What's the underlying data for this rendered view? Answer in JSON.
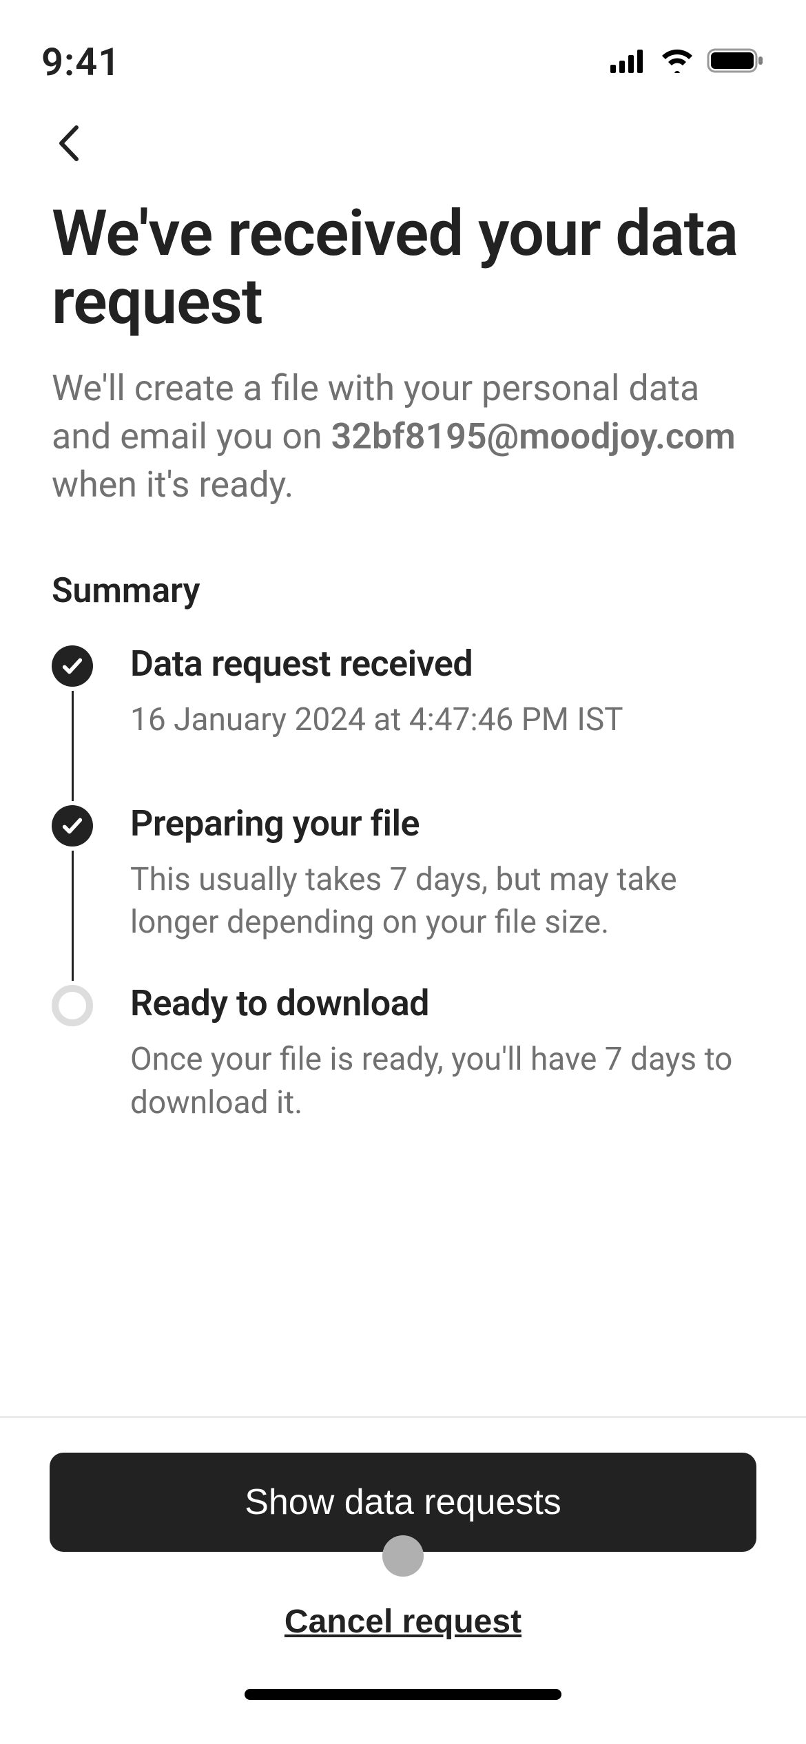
{
  "status_bar": {
    "time": "9:41"
  },
  "page": {
    "title": "We've received your data request",
    "subtitle_pre": "We'll create a file with your personal data and email you on ",
    "subtitle_email": "32bf8195@moodjoy.com",
    "subtitle_post": " when it's ready."
  },
  "summary": {
    "heading": "Summary",
    "steps": [
      {
        "title": "Data request received",
        "desc": "16 January 2024 at 4:47:46 PM IST",
        "done": true
      },
      {
        "title": "Preparing your file",
        "desc": "This usually takes 7 days, but may take longer depending on your file size.",
        "done": true
      },
      {
        "title": "Ready to download",
        "desc": "Once your file is ready, you'll have 7 days to download it.",
        "done": false
      }
    ]
  },
  "actions": {
    "primary": "Show data requests",
    "secondary": "Cancel request"
  }
}
